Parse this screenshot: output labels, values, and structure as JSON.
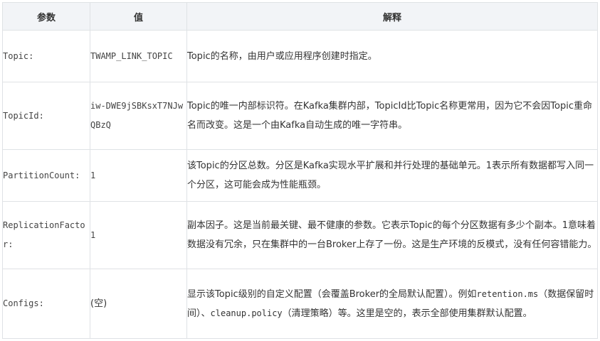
{
  "table": {
    "headers": [
      "参数",
      "值",
      "解释"
    ],
    "rows": [
      {
        "param": "Topic:",
        "value": "TWAMP_LINK_TOPIC",
        "desc_parts": [
          "Topic的名称，由用户或应用程序创建时指定。"
        ]
      },
      {
        "param": "TopicId:",
        "value": "iw-DWE9jSBKsxT7NJwQBzQ",
        "desc_parts": [
          "Topic的唯一内部标识符。在Kafka集群内部，TopicId比Topic名称更常用，因为它不会因Topic重命名而改变。这是一个由Kafka自动生成的唯一字符串。"
        ]
      },
      {
        "param": "PartitionCount:",
        "value": "1",
        "desc_parts": [
          "该Topic的分区总数。分区是Kafka实现水平扩展和并行处理的基础单元。1表示所有数据都写入同一个分区，这可能会成为性能瓶颈。"
        ]
      },
      {
        "param": "ReplicationFactor:",
        "value": "1",
        "desc_parts": [
          "副本因子。这是当前最关键、最不健康的参数。它表示Topic的每个分区数据有多少个副本。1意味着数据没有冗余，只在集群中的一台Broker上存了一份。这是生产环境的反模式，没有任何容错能力。"
        ]
      },
      {
        "param": "Configs:",
        "value": "(空)",
        "desc_parts": [
          "显示该Topic级别的自定义配置（会覆盖Broker的全局默认配置）。例如",
          "retention.ms",
          "（数据保留时间）、",
          "cleanup.policy",
          "（清理策略）等。这里是空的，表示全部使用集群默认配置。"
        ]
      }
    ]
  }
}
